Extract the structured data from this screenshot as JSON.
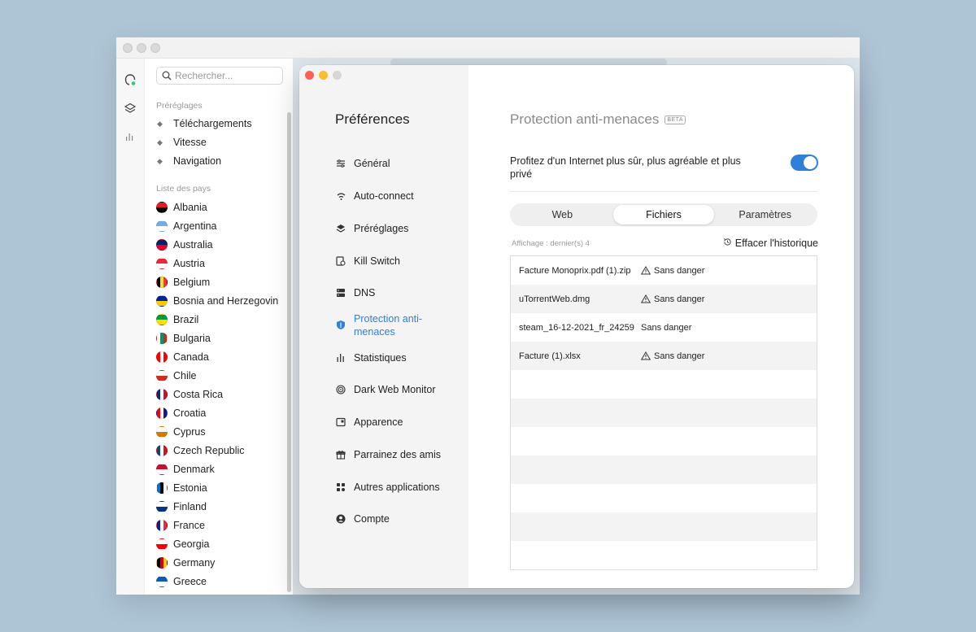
{
  "search": {
    "placeholder": "Rechercher..."
  },
  "presets": {
    "heading": "Préréglages",
    "items": [
      "Téléchargements",
      "Vitesse",
      "Navigation"
    ]
  },
  "countries": {
    "heading": "Liste des pays",
    "items": [
      {
        "name": "Albania",
        "colors": [
          "#e41e20",
          "#000000"
        ]
      },
      {
        "name": "Argentina",
        "colors": [
          "#74acdf",
          "#ffffff"
        ]
      },
      {
        "name": "Australia",
        "colors": [
          "#012169",
          "#e4002b"
        ]
      },
      {
        "name": "Austria",
        "colors": [
          "#ed2939",
          "#ffffff"
        ]
      },
      {
        "name": "Belgium",
        "colors": [
          "#000000",
          "#fdda24",
          "#ef3340"
        ]
      },
      {
        "name": "Bosnia and Herzegovin",
        "colors": [
          "#002395",
          "#fecb00"
        ]
      },
      {
        "name": "Brazil",
        "colors": [
          "#009c3b",
          "#ffdf00"
        ]
      },
      {
        "name": "Bulgaria",
        "colors": [
          "#ffffff",
          "#00966e",
          "#d62612"
        ]
      },
      {
        "name": "Canada",
        "colors": [
          "#ff0000",
          "#ffffff",
          "#ff0000"
        ]
      },
      {
        "name": "Chile",
        "colors": [
          "#ffffff",
          "#d52b1e"
        ]
      },
      {
        "name": "Costa Rica",
        "colors": [
          "#002b7f",
          "#ffffff",
          "#ce1126"
        ]
      },
      {
        "name": "Croatia",
        "colors": [
          "#ff0000",
          "#ffffff",
          "#171796"
        ]
      },
      {
        "name": "Cyprus",
        "colors": [
          "#ffffff",
          "#d57800"
        ]
      },
      {
        "name": "Czech Republic",
        "colors": [
          "#11457e",
          "#ffffff",
          "#d7141a"
        ]
      },
      {
        "name": "Denmark",
        "colors": [
          "#c8102e",
          "#ffffff"
        ]
      },
      {
        "name": "Estonia",
        "colors": [
          "#0072ce",
          "#000000",
          "#ffffff"
        ]
      },
      {
        "name": "Finland",
        "colors": [
          "#ffffff",
          "#003580"
        ]
      },
      {
        "name": "France",
        "colors": [
          "#002395",
          "#ffffff",
          "#ed2939"
        ]
      },
      {
        "name": "Georgia",
        "colors": [
          "#ffffff",
          "#ff0000"
        ]
      },
      {
        "name": "Germany",
        "colors": [
          "#000000",
          "#dd0000",
          "#ffce00"
        ]
      },
      {
        "name": "Greece",
        "colors": [
          "#0d5eaf",
          "#ffffff"
        ]
      }
    ]
  },
  "prefs": {
    "title": "Préférences",
    "nav": [
      {
        "label": "Général",
        "icon": "sliders-icon"
      },
      {
        "label": "Auto-connect",
        "icon": "wifi-icon"
      },
      {
        "label": "Préréglages",
        "icon": "layers-icon"
      },
      {
        "label": "Kill Switch",
        "icon": "kill-switch-icon"
      },
      {
        "label": "DNS",
        "icon": "server-icon"
      },
      {
        "label": "Protection anti-menaces",
        "icon": "shield-icon"
      },
      {
        "label": "Statistiques",
        "icon": "bar-chart-icon"
      },
      {
        "label": "Dark Web Monitor",
        "icon": "radar-icon"
      },
      {
        "label": "Apparence",
        "icon": "window-icon"
      },
      {
        "label": "Parrainez des amis",
        "icon": "gift-icon"
      },
      {
        "label": "Autres applications",
        "icon": "apps-grid-icon"
      },
      {
        "label": "Compte",
        "icon": "user-circle-icon"
      }
    ],
    "active_index": 5,
    "accent_color": "#2f80d8"
  },
  "main": {
    "title": "Protection anti-menaces",
    "beta": "BETA",
    "description": "Profitez d'un Internet plus sûr, plus agréable et plus privé",
    "toggle_on": true,
    "tabs": [
      "Web",
      "Fichiers",
      "Paramètres"
    ],
    "active_tab": 1,
    "history_label": "Affichage : dernier(s) 4",
    "clear_history": "Effacer l'historique",
    "files": [
      {
        "name": "Facture Monoprix.pdf (1).zip",
        "status": "Sans danger",
        "warn": true
      },
      {
        "name": "uTorrentWeb.dmg",
        "status": "Sans danger",
        "warn": true
      },
      {
        "name": "steam_16-12-2021_fr_24259",
        "status": "Sans danger",
        "warn": false
      },
      {
        "name": "Facture (1).xlsx",
        "status": "Sans danger",
        "warn": true
      }
    ]
  }
}
